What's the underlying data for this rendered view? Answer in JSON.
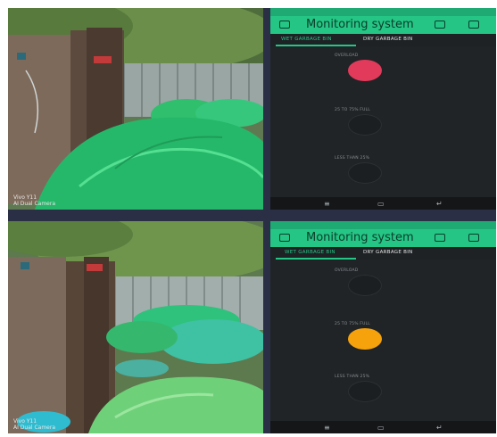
{
  "photos": [
    {
      "caption_line1": "Vivo Y11",
      "caption_line2": "AI Dual Camera"
    },
    {
      "caption_line1": "Vivo Y11",
      "caption_line2": "AI Dual Camera"
    }
  ],
  "screens": [
    {
      "title": "Monitoring system",
      "tabs": [
        {
          "label": "WET GARBAGE BIN",
          "active": true
        },
        {
          "label": "DRY GARBAGE BIN",
          "active": false
        }
      ],
      "widgets": [
        {
          "label": "OVERLOAD",
          "led_color": "#e23a5a",
          "on": true
        },
        {
          "label": "25 TO 75% FULL",
          "led_color": "#f5a20c",
          "on": false
        },
        {
          "label": "LESS THAN 25%",
          "led_color": "#2bd07a",
          "on": false
        }
      ],
      "nav": [
        "≡",
        "▭",
        "↵"
      ]
    },
    {
      "title": "Monitoring system",
      "tabs": [
        {
          "label": "WET GARBAGE BIN",
          "active": true
        },
        {
          "label": "DRY GARBAGE BIN",
          "active": false
        }
      ],
      "widgets": [
        {
          "label": "OVERLOAD",
          "led_color": "#e23a5a",
          "on": false
        },
        {
          "label": "25 TO 75% FULL",
          "led_color": "#f5a20c",
          "on": true
        },
        {
          "label": "LESS THAN 25%",
          "led_color": "#2bd07a",
          "on": false
        }
      ],
      "nav": [
        "≡",
        "▭",
        "↵"
      ]
    }
  ],
  "colors": {
    "accent": "#25c585",
    "phone_bg": "#202427"
  }
}
